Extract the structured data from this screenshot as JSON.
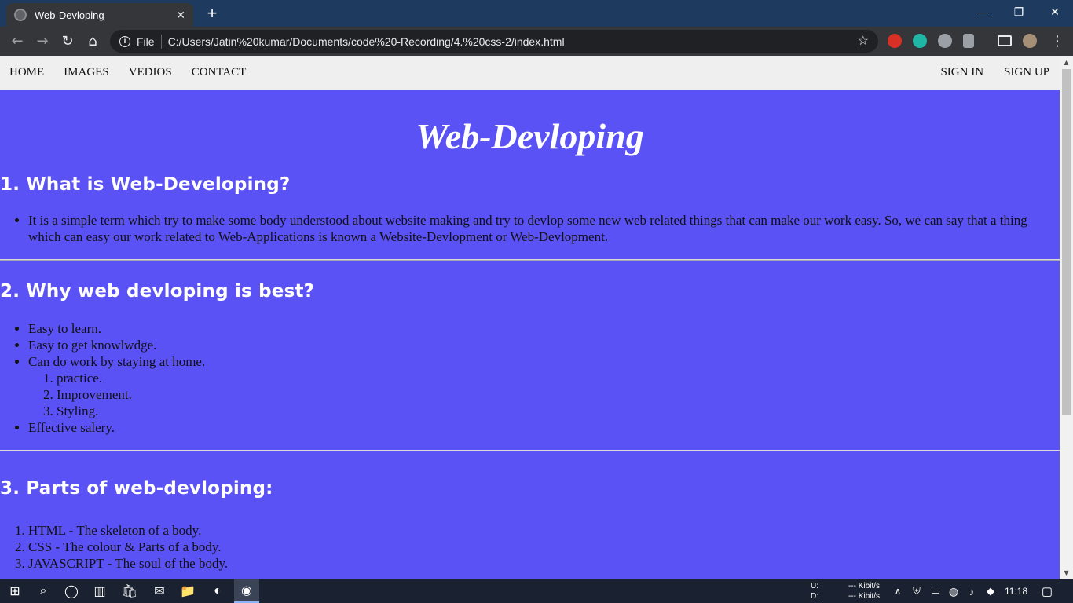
{
  "browser": {
    "tab_title": "Web-Devloping",
    "tab_close": "✕",
    "new_tab": "+",
    "scheme_label": "File",
    "url": "C:/Users/Jatin%20kumar/Documents/code%20-Recording/4.%20css-2/index.html"
  },
  "site_nav": {
    "left": [
      "HOME",
      "IMAGES",
      "VEDIOS",
      "CONTACT"
    ],
    "right": [
      "SIGN IN",
      "SIGN UP"
    ]
  },
  "page": {
    "title": "Web-Devloping",
    "section1": {
      "heading": "1. What is Web-Developing?",
      "items": [
        "It is a simple term which try to make some body understood about website making and try to devlop some new web related things that can make our work easy. So, we can say that a thing which can easy our work related to Web-Applications is known a Website-Devlopment or Web-Devlopment."
      ]
    },
    "section2": {
      "heading": "2. Why web devloping is best?",
      "items": [
        "Easy to learn.",
        "Easy to get knowlwdge.",
        "Can do work by staying at home."
      ],
      "sub_items": [
        "practice.",
        "Improvement.",
        "Styling."
      ],
      "last_item": "Effective salery."
    },
    "section3": {
      "heading": "3. Parts of web-devloping:",
      "items": [
        {
          "name": "HTML",
          "desc": " - The skeleton of a body."
        },
        {
          "name": "CSS",
          "desc": " - The colour & Parts of a body."
        },
        {
          "name": "JAVASCRIPT",
          "desc": " - The soul of the body."
        }
      ]
    }
  },
  "taskbar": {
    "upload_label": "U:",
    "download_label": "D:",
    "upload_rate": "--- Kibit/s",
    "download_rate": "--- Kibit/s",
    "clock": "11:18"
  },
  "colors": {
    "page_background": "#5b52f5",
    "nav_background": "#efefef",
    "title_bar": "#1f3a5f"
  }
}
